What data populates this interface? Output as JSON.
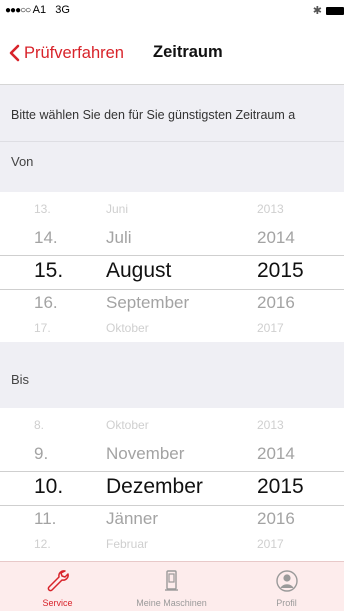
{
  "status_bar": {
    "signal": "●●●○○",
    "carrier": "A1",
    "network": "3G",
    "bluetooth_icon": "bluetooth-icon",
    "battery_icon": "battery-icon"
  },
  "nav": {
    "back_label": "Prüfverfahren",
    "title": "Zeitraum",
    "accent_color": "#d8232a"
  },
  "intro_text": "Bitte wählen Sie den für Sie günstigsten Zeitraum a",
  "von": {
    "label": "Von",
    "rows": [
      {
        "day": "13.",
        "month": "Juni",
        "year": "2013"
      },
      {
        "day": "14.",
        "month": "Juli",
        "year": "2014"
      },
      {
        "day": "15.",
        "month": "August",
        "year": "2015"
      },
      {
        "day": "16.",
        "month": "September",
        "year": "2016"
      },
      {
        "day": "17.",
        "month": "Oktober",
        "year": "2017"
      }
    ],
    "selected": {
      "day": "15.",
      "month": "August",
      "year": "2015"
    }
  },
  "bis": {
    "label": "Bis",
    "rows": [
      {
        "day": "8.",
        "month": "Oktober",
        "year": "2013"
      },
      {
        "day": "9.",
        "month": "November",
        "year": "2014"
      },
      {
        "day": "10.",
        "month": "Dezember",
        "year": "2015"
      },
      {
        "day": "11.",
        "month": "Jänner",
        "year": "2016"
      },
      {
        "day": "12.",
        "month": "Februar",
        "year": "2017"
      }
    ],
    "selected": {
      "day": "10.",
      "month": "Dezember",
      "year": "2015"
    }
  },
  "tabs": [
    {
      "label": "Service",
      "icon": "wrench-icon",
      "active": true
    },
    {
      "label": "Meine Maschinen",
      "icon": "machine-icon",
      "active": false
    },
    {
      "label": "Profil",
      "icon": "profile-icon",
      "active": false
    }
  ]
}
